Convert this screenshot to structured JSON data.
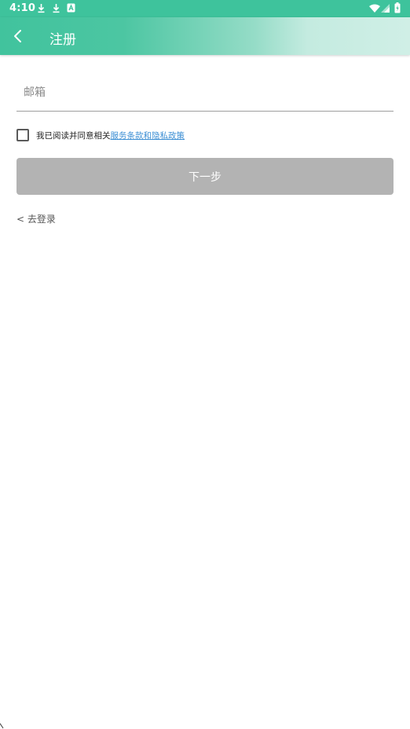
{
  "status_bar": {
    "time": "4:10",
    "left_icons": [
      "download-icon",
      "download-icon",
      "text-notification-icon"
    ],
    "right_icons": [
      "wifi-icon",
      "cell-signal-icon",
      "battery-charging-icon"
    ]
  },
  "toolbar": {
    "title": "注册",
    "back_icon": "chevron-left-icon",
    "gradient_colors": [
      "#41c39d",
      "#d0efe6"
    ]
  },
  "form": {
    "email_placeholder": "邮箱",
    "email_value": "",
    "agree_checked": false,
    "agree_text": "我已阅读并同意相关",
    "agree_link": "服务条款和隐私政策",
    "next_button": "下一步",
    "login_link": "< 去登录"
  },
  "colors": {
    "accent": "#3ec39c",
    "link": "#3d8fd4",
    "button_disabled": "#b3b3b3"
  }
}
